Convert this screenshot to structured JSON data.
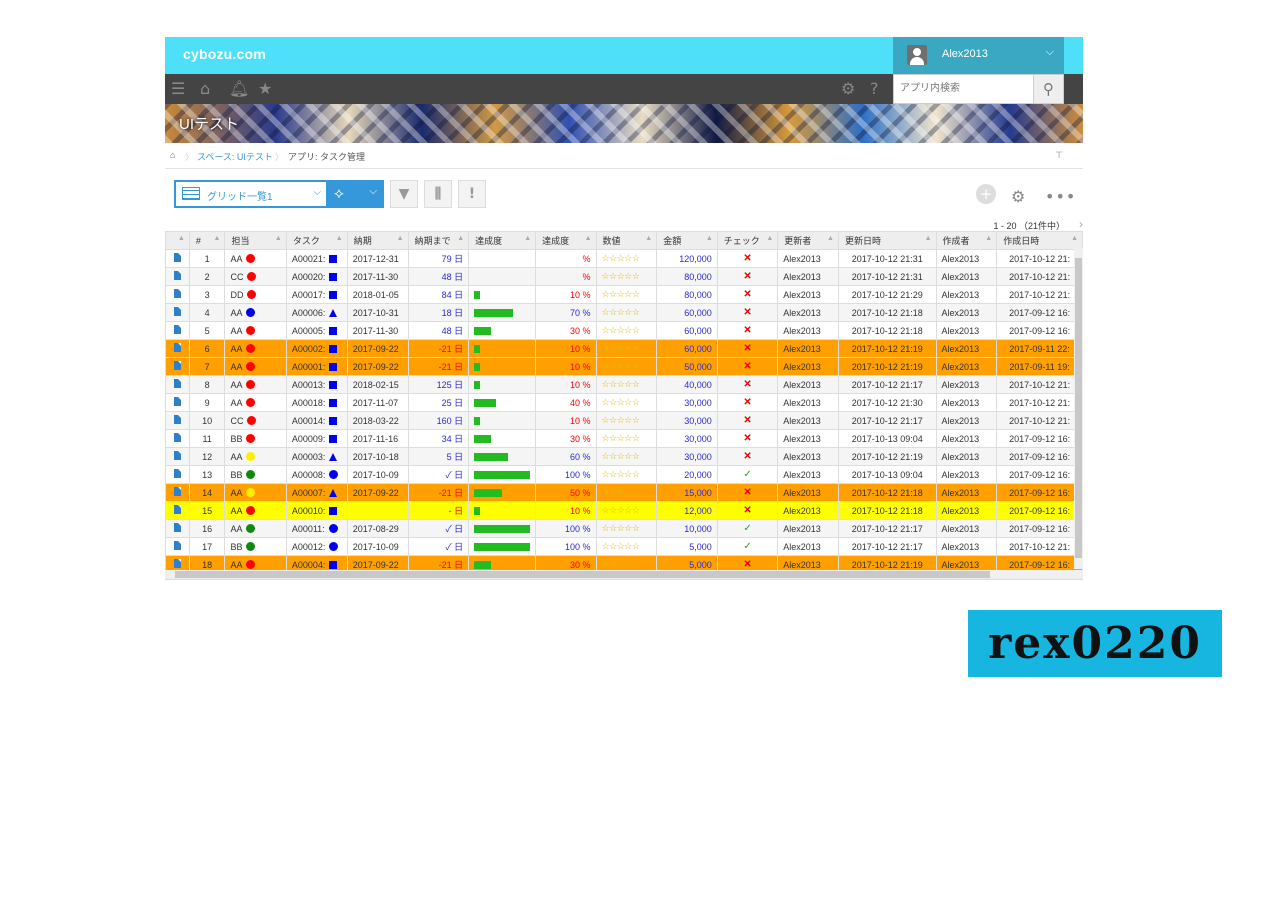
{
  "header": {
    "logo": "cybozu.com",
    "user_name": "Alex2013"
  },
  "search": {
    "placeholder": "アプリ内検索"
  },
  "app": {
    "title": "UIテスト"
  },
  "breadcrumb": {
    "space": "スペース: UIテスト",
    "app": "アプリ: タスク管理"
  },
  "view": {
    "name": "グリッド一覧1"
  },
  "pager": {
    "text": "1 - 20 （21件中）"
  },
  "columns": [
    "#",
    "担当",
    "タスク",
    "納期",
    "納期まで",
    "達成度",
    "達成度",
    "数値",
    "金額",
    "チェック",
    "更新者",
    "更新日時",
    "作成者",
    "作成日時"
  ],
  "rows": [
    {
      "n": "1",
      "who": "AA",
      "who_color": "#ff0000",
      "task": "A00021:",
      "shape": "sq",
      "due": "2017-12-31",
      "until": "79 日",
      "until_cls": "blue",
      "bar": 0,
      "pct": "%",
      "stars": "☆☆☆☆☆",
      "amount": "120,000",
      "check": "x",
      "updater": "Alex2013",
      "updated": "2017-10-12 21:31",
      "creator": "Alex2013",
      "created": "2017-10-12 21:",
      "style": "odd"
    },
    {
      "n": "2",
      "who": "CC",
      "who_color": "#ff0000",
      "task": "A00020:",
      "shape": "sq",
      "due": "2017-11-30",
      "until": "48 日",
      "until_cls": "blue",
      "bar": 0,
      "pct": "%",
      "stars": "☆☆☆☆☆",
      "amount": "80,000",
      "check": "x",
      "updater": "Alex2013",
      "updated": "2017-10-12 21:31",
      "creator": "Alex2013",
      "created": "2017-10-12 21:",
      "style": "even"
    },
    {
      "n": "3",
      "who": "DD",
      "who_color": "#ff0000",
      "task": "A00017:",
      "shape": "sq",
      "due": "2018-01-05",
      "until": "84 日",
      "until_cls": "blue",
      "bar": 0.1,
      "pct": "10 %",
      "stars": "☆☆☆☆☆",
      "amount": "80,000",
      "check": "x",
      "updater": "Alex2013",
      "updated": "2017-10-12 21:29",
      "creator": "Alex2013",
      "created": "2017-10-12 21:",
      "style": "odd"
    },
    {
      "n": "4",
      "who": "AA",
      "who_color": "#0000ee",
      "task": "A00006:",
      "shape": "tri",
      "due": "2017-10-31",
      "until": "18 日",
      "until_cls": "blue",
      "bar": 0.7,
      "pct": "70 %",
      "stars": "☆☆☆☆☆",
      "amount": "60,000",
      "check": "x",
      "updater": "Alex2013",
      "updated": "2017-10-12 21:18",
      "creator": "Alex2013",
      "created": "2017-09-12 16:",
      "style": "even"
    },
    {
      "n": "5",
      "who": "AA",
      "who_color": "#ff0000",
      "task": "A00005:",
      "shape": "sq",
      "due": "2017-11-30",
      "until": "48 日",
      "until_cls": "blue",
      "bar": 0.3,
      "pct": "30 %",
      "stars": "☆☆☆☆☆",
      "amount": "60,000",
      "check": "x",
      "updater": "Alex2013",
      "updated": "2017-10-12 21:18",
      "creator": "Alex2013",
      "created": "2017-09-12 16:",
      "style": "odd"
    },
    {
      "n": "6",
      "who": "AA",
      "who_color": "#ff0000",
      "task": "A00002:",
      "shape": "sq",
      "due": "2017-09-22",
      "until": "-21 日",
      "until_cls": "red",
      "bar": 0.1,
      "pct": "10 %",
      "stars": "★★★★★",
      "amount": "60,000",
      "check": "x",
      "updater": "Alex2013",
      "updated": "2017-10-12 21:19",
      "creator": "Alex2013",
      "created": "2017-09-11 22:",
      "style": "orange"
    },
    {
      "n": "7",
      "who": "AA",
      "who_color": "#ff0000",
      "task": "A00001:",
      "shape": "sq",
      "due": "2017-09-22",
      "until": "-21 日",
      "until_cls": "red",
      "bar": 0.1,
      "pct": "10 %",
      "stars": "★★★★★",
      "amount": "50,000",
      "check": "x",
      "updater": "Alex2013",
      "updated": "2017-10-12 21:19",
      "creator": "Alex2013",
      "created": "2017-09-11 19:",
      "style": "orange"
    },
    {
      "n": "8",
      "who": "AA",
      "who_color": "#ff0000",
      "task": "A00013:",
      "shape": "sq",
      "due": "2018-02-15",
      "until": "125 日",
      "until_cls": "blue",
      "bar": 0.1,
      "pct": "10 %",
      "stars": "☆☆☆☆☆",
      "amount": "40,000",
      "check": "x",
      "updater": "Alex2013",
      "updated": "2017-10-12 21:17",
      "creator": "Alex2013",
      "created": "2017-10-12 21:",
      "style": "even"
    },
    {
      "n": "9",
      "who": "AA",
      "who_color": "#ff0000",
      "task": "A00018:",
      "shape": "sq",
      "due": "2017-11-07",
      "until": "25 日",
      "until_cls": "blue",
      "bar": 0.4,
      "pct": "40 %",
      "stars": "☆☆☆☆☆",
      "amount": "30,000",
      "check": "x",
      "updater": "Alex2013",
      "updated": "2017-10-12 21:30",
      "creator": "Alex2013",
      "created": "2017-10-12 21:",
      "style": "odd"
    },
    {
      "n": "10",
      "who": "CC",
      "who_color": "#ff0000",
      "task": "A00014:",
      "shape": "sq",
      "due": "2018-03-22",
      "until": "160 日",
      "until_cls": "blue",
      "bar": 0.1,
      "pct": "10 %",
      "stars": "☆☆☆☆☆",
      "amount": "30,000",
      "check": "x",
      "updater": "Alex2013",
      "updated": "2017-10-12 21:17",
      "creator": "Alex2013",
      "created": "2017-10-12 21:",
      "style": "even"
    },
    {
      "n": "11",
      "who": "BB",
      "who_color": "#ff0000",
      "task": "A00009:",
      "shape": "sq",
      "due": "2017-11-16",
      "until": "34 日",
      "until_cls": "blue",
      "bar": 0.3,
      "pct": "30 %",
      "stars": "☆☆☆☆☆",
      "amount": "30,000",
      "check": "x",
      "updater": "Alex2013",
      "updated": "2017-10-13 09:04",
      "creator": "Alex2013",
      "created": "2017-09-12 16:",
      "style": "odd"
    },
    {
      "n": "12",
      "who": "AA",
      "who_color": "#ffee00",
      "task": "A00003:",
      "shape": "tri",
      "due": "2017-10-18",
      "until": "5 日",
      "until_cls": "blue",
      "bar": 0.6,
      "pct": "60 %",
      "stars": "☆☆☆☆☆",
      "amount": "30,000",
      "check": "x",
      "updater": "Alex2013",
      "updated": "2017-10-12 21:19",
      "creator": "Alex2013",
      "created": "2017-09-12 16:",
      "style": "even"
    },
    {
      "n": "13",
      "who": "BB",
      "who_color": "#118811",
      "task": "A00008:",
      "shape": "circ",
      "due": "2017-10-09",
      "until": "✓ 日",
      "until_cls": "blue",
      "bar": 1,
      "pct": "100 %",
      "stars": "☆☆☆☆☆",
      "amount": "20,000",
      "check": "ok",
      "updater": "Alex2013",
      "updated": "2017-10-13 09:04",
      "creator": "Alex2013",
      "created": "2017-09-12 16:",
      "style": "odd"
    },
    {
      "n": "14",
      "who": "AA",
      "who_color": "#ffee00",
      "task": "A00007:",
      "shape": "tri",
      "due": "2017-09-22",
      "until": "-21 日",
      "until_cls": "red",
      "bar": 0.5,
      "pct": "50 %",
      "stars": "★★★☆☆",
      "amount": "15,000",
      "check": "x",
      "updater": "Alex2013",
      "updated": "2017-10-12 21:18",
      "creator": "Alex2013",
      "created": "2017-09-12 16:",
      "style": "orange"
    },
    {
      "n": "15",
      "who": "AA",
      "who_color": "#ff0000",
      "task": "A00010:",
      "shape": "sq",
      "due": "",
      "until": "- 日",
      "until_cls": "red",
      "bar": 0.1,
      "pct": "10 %",
      "stars": "☆☆☆☆☆",
      "amount": "12,000",
      "check": "x",
      "updater": "Alex2013",
      "updated": "2017-10-12 21:18",
      "creator": "Alex2013",
      "created": "2017-09-12 16:",
      "style": "yellow"
    },
    {
      "n": "16",
      "who": "AA",
      "who_color": "#118811",
      "task": "A00011:",
      "shape": "circ",
      "due": "2017-08-29",
      "until": "✓ 日",
      "until_cls": "blue",
      "bar": 1,
      "pct": "100 %",
      "stars": "☆☆☆☆☆",
      "amount": "10,000",
      "check": "ok",
      "updater": "Alex2013",
      "updated": "2017-10-12 21:17",
      "creator": "Alex2013",
      "created": "2017-09-12 16:",
      "style": "even"
    },
    {
      "n": "17",
      "who": "BB",
      "who_color": "#118811",
      "task": "A00012:",
      "shape": "circ",
      "due": "2017-10-09",
      "until": "✓ 日",
      "until_cls": "blue",
      "bar": 1,
      "pct": "100 %",
      "stars": "☆☆☆☆☆",
      "amount": "5,000",
      "check": "ok",
      "updater": "Alex2013",
      "updated": "2017-10-12 21:17",
      "creator": "Alex2013",
      "created": "2017-10-12 21:",
      "style": "odd"
    },
    {
      "n": "18",
      "who": "AA",
      "who_color": "#ff0000",
      "task": "A00004:",
      "shape": "sq",
      "due": "2017-09-22",
      "until": "-21 日",
      "until_cls": "red",
      "bar": 0.3,
      "pct": "30 %",
      "stars": "★★☆☆☆",
      "amount": "5,000",
      "check": "x",
      "updater": "Alex2013",
      "updated": "2017-10-12 21:19",
      "creator": "Alex2013",
      "created": "2017-09-12 16:",
      "style": "orange"
    }
  ],
  "watermark": {
    "text": "rex0220"
  }
}
